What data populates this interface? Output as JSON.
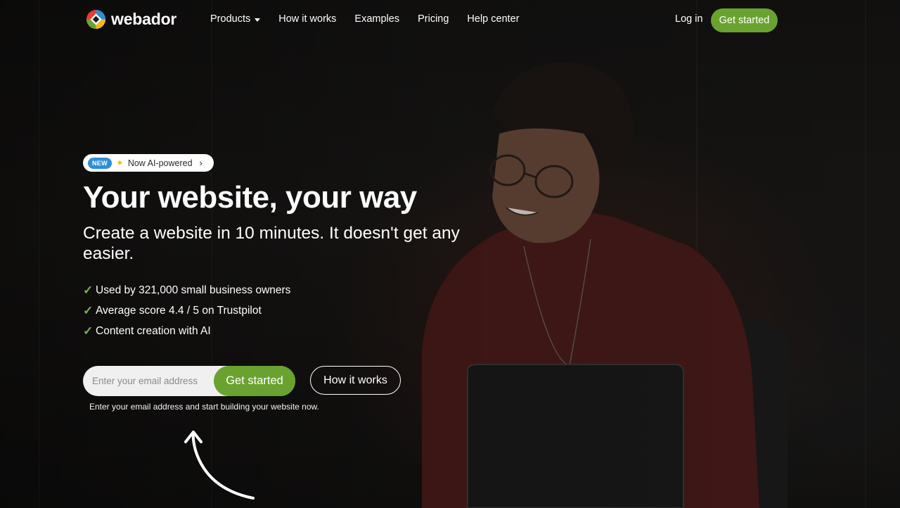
{
  "nav": {
    "brand": "webador",
    "links": [
      {
        "label": "Products",
        "has_dropdown": true
      },
      {
        "label": "How it works"
      },
      {
        "label": "Examples"
      },
      {
        "label": "Pricing"
      },
      {
        "label": "Help center"
      }
    ],
    "login": "Log in",
    "cta": "Get started"
  },
  "hero": {
    "pill": {
      "badge": "NEW",
      "text": "Now AI-powered"
    },
    "title": "Your website, your way",
    "subtitle": "Create a website in 10 minutes. It doesn't get any easier.",
    "features": [
      "Used by 321,000 small business owners",
      "Average score 4.4 / 5 on Trustpilot",
      "Content creation with AI"
    ],
    "signup": {
      "placeholder": "Enter your email address",
      "button": "Get started",
      "helper": "Enter your email address and start building your website now."
    },
    "secondary_button": "How it works"
  },
  "colors": {
    "accent_green": "#6aa22f",
    "badge_blue": "#2f8ed6",
    "check_green": "#7cb342"
  }
}
